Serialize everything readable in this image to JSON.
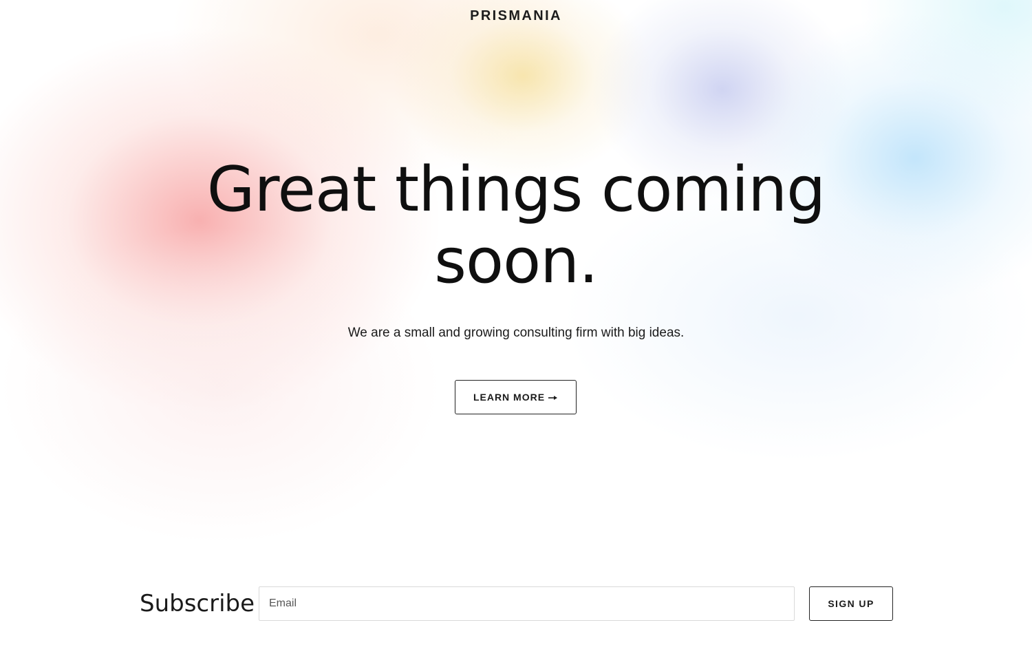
{
  "brand": {
    "name": "PRISMANIA"
  },
  "hero": {
    "title": "Great things coming soon.",
    "subtitle": "We are a small and growing consulting firm with big ideas.",
    "cta_label": "LEARN MORE",
    "cta_icon": "arrow-right-icon"
  },
  "subscribe": {
    "label": "Subscribe",
    "email_placeholder": "Email",
    "email_value": "",
    "button_label": "SIGN UP"
  },
  "colors": {
    "text": "#111111",
    "background": "#ffffff",
    "gradient_red": "#f69696",
    "gradient_yellow": "#f5de96",
    "gradient_violet": "#c8cdf0",
    "gradient_blue": "#b9e1fa"
  }
}
